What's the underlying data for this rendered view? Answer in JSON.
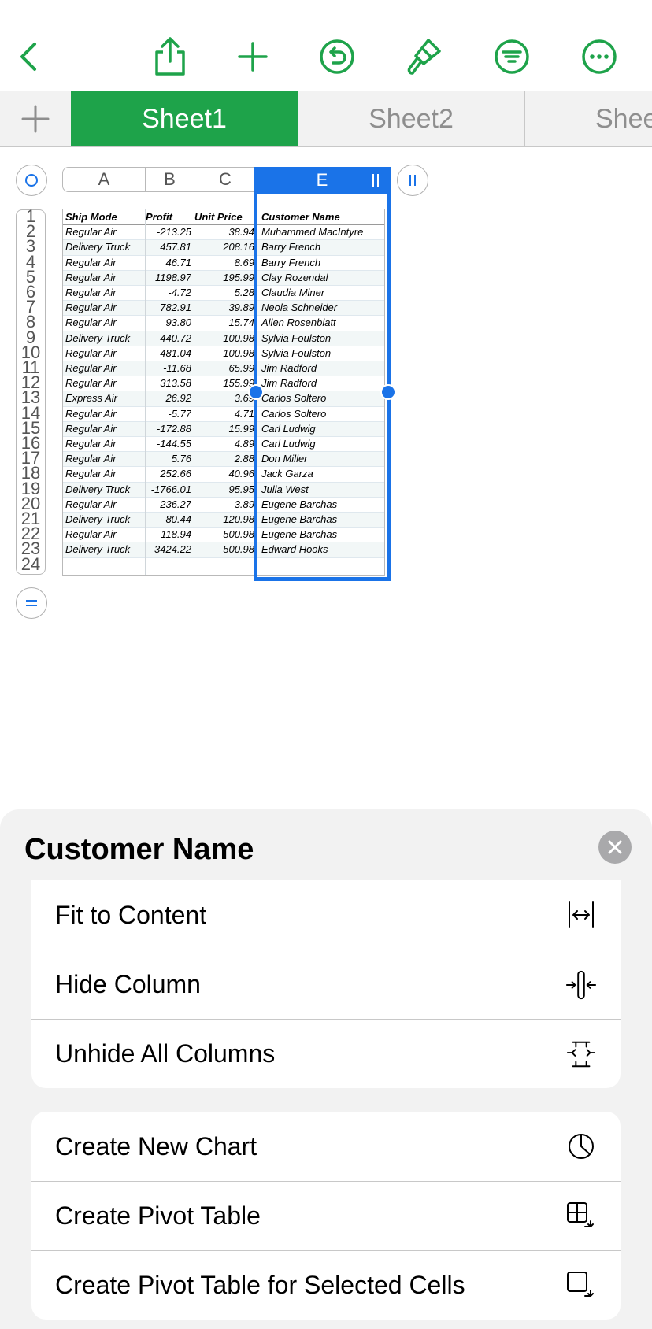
{
  "toolbar": {
    "icons": [
      "chevron-left-icon",
      "share-icon",
      "plus-icon",
      "undo-icon",
      "paintbrush-icon",
      "filter-icon",
      "more-icon"
    ],
    "accent": "#1ea34a"
  },
  "tabs": [
    {
      "label": "Sheet1",
      "active": true
    },
    {
      "label": "Sheet2",
      "active": false
    },
    {
      "label": "Shee",
      "active": false
    }
  ],
  "columns": [
    "A",
    "B",
    "C",
    "E"
  ],
  "table": {
    "headers": [
      "Ship Mode",
      "Profit",
      "Unit Price",
      "Customer Name"
    ],
    "rows": [
      [
        "Regular Air",
        "-213.25",
        "38.94",
        "Muhammed MacIntyre"
      ],
      [
        "Delivery Truck",
        "457.81",
        "208.16",
        "Barry French"
      ],
      [
        "Regular Air",
        "46.71",
        "8.69",
        "Barry French"
      ],
      [
        "Regular Air",
        "1198.97",
        "195.99",
        "Clay Rozendal"
      ],
      [
        "Regular Air",
        "-4.72",
        "5.28",
        "Claudia Miner"
      ],
      [
        "Regular Air",
        "782.91",
        "39.89",
        "Neola Schneider"
      ],
      [
        "Regular Air",
        "93.80",
        "15.74",
        "Allen Rosenblatt"
      ],
      [
        "Delivery Truck",
        "440.72",
        "100.98",
        "Sylvia Foulston"
      ],
      [
        "Regular Air",
        "-481.04",
        "100.98",
        "Sylvia Foulston"
      ],
      [
        "Regular Air",
        "-11.68",
        "65.99",
        "Jim Radford"
      ],
      [
        "Regular Air",
        "313.58",
        "155.99",
        "Jim Radford"
      ],
      [
        "Express Air",
        "26.92",
        "3.69",
        "Carlos Soltero"
      ],
      [
        "Regular Air",
        "-5.77",
        "4.71",
        "Carlos Soltero"
      ],
      [
        "Regular Air",
        "-172.88",
        "15.99",
        "Carl Ludwig"
      ],
      [
        "Regular Air",
        "-144.55",
        "4.89",
        "Carl Ludwig"
      ],
      [
        "Regular Air",
        "5.76",
        "2.88",
        "Don Miller"
      ],
      [
        "Regular Air",
        "252.66",
        "40.96",
        "Jack Garza"
      ],
      [
        "Delivery Truck",
        "-1766.01",
        "95.95",
        "Julia West"
      ],
      [
        "Regular Air",
        "-236.27",
        "3.89",
        "Eugene Barchas"
      ],
      [
        "Delivery Truck",
        "80.44",
        "120.98",
        "Eugene Barchas"
      ],
      [
        "Regular Air",
        "118.94",
        "500.98",
        "Eugene Barchas"
      ],
      [
        "Delivery Truck",
        "3424.22",
        "500.98",
        "Edward Hooks"
      ]
    ]
  },
  "row_numbers": [
    "1",
    "2",
    "3",
    "4",
    "5",
    "6",
    "7",
    "8",
    "9",
    "10",
    "11",
    "12",
    "13",
    "14",
    "15",
    "16",
    "17",
    "18",
    "19",
    "20",
    "21",
    "22",
    "23",
    "24"
  ],
  "sheet": {
    "title": "Customer Name",
    "group1": [
      {
        "label": "Fit to Content",
        "icon": "fit-to-content-icon"
      },
      {
        "label": "Hide Column",
        "icon": "hide-column-icon"
      },
      {
        "label": "Unhide All Columns",
        "icon": "unhide-columns-icon"
      }
    ],
    "group2": [
      {
        "label": "Create New Chart",
        "icon": "chart-icon"
      },
      {
        "label": "Create Pivot Table",
        "icon": "pivot-table-icon"
      },
      {
        "label": "Create Pivot Table for Selected Cells",
        "icon": "pivot-selected-icon"
      }
    ]
  }
}
